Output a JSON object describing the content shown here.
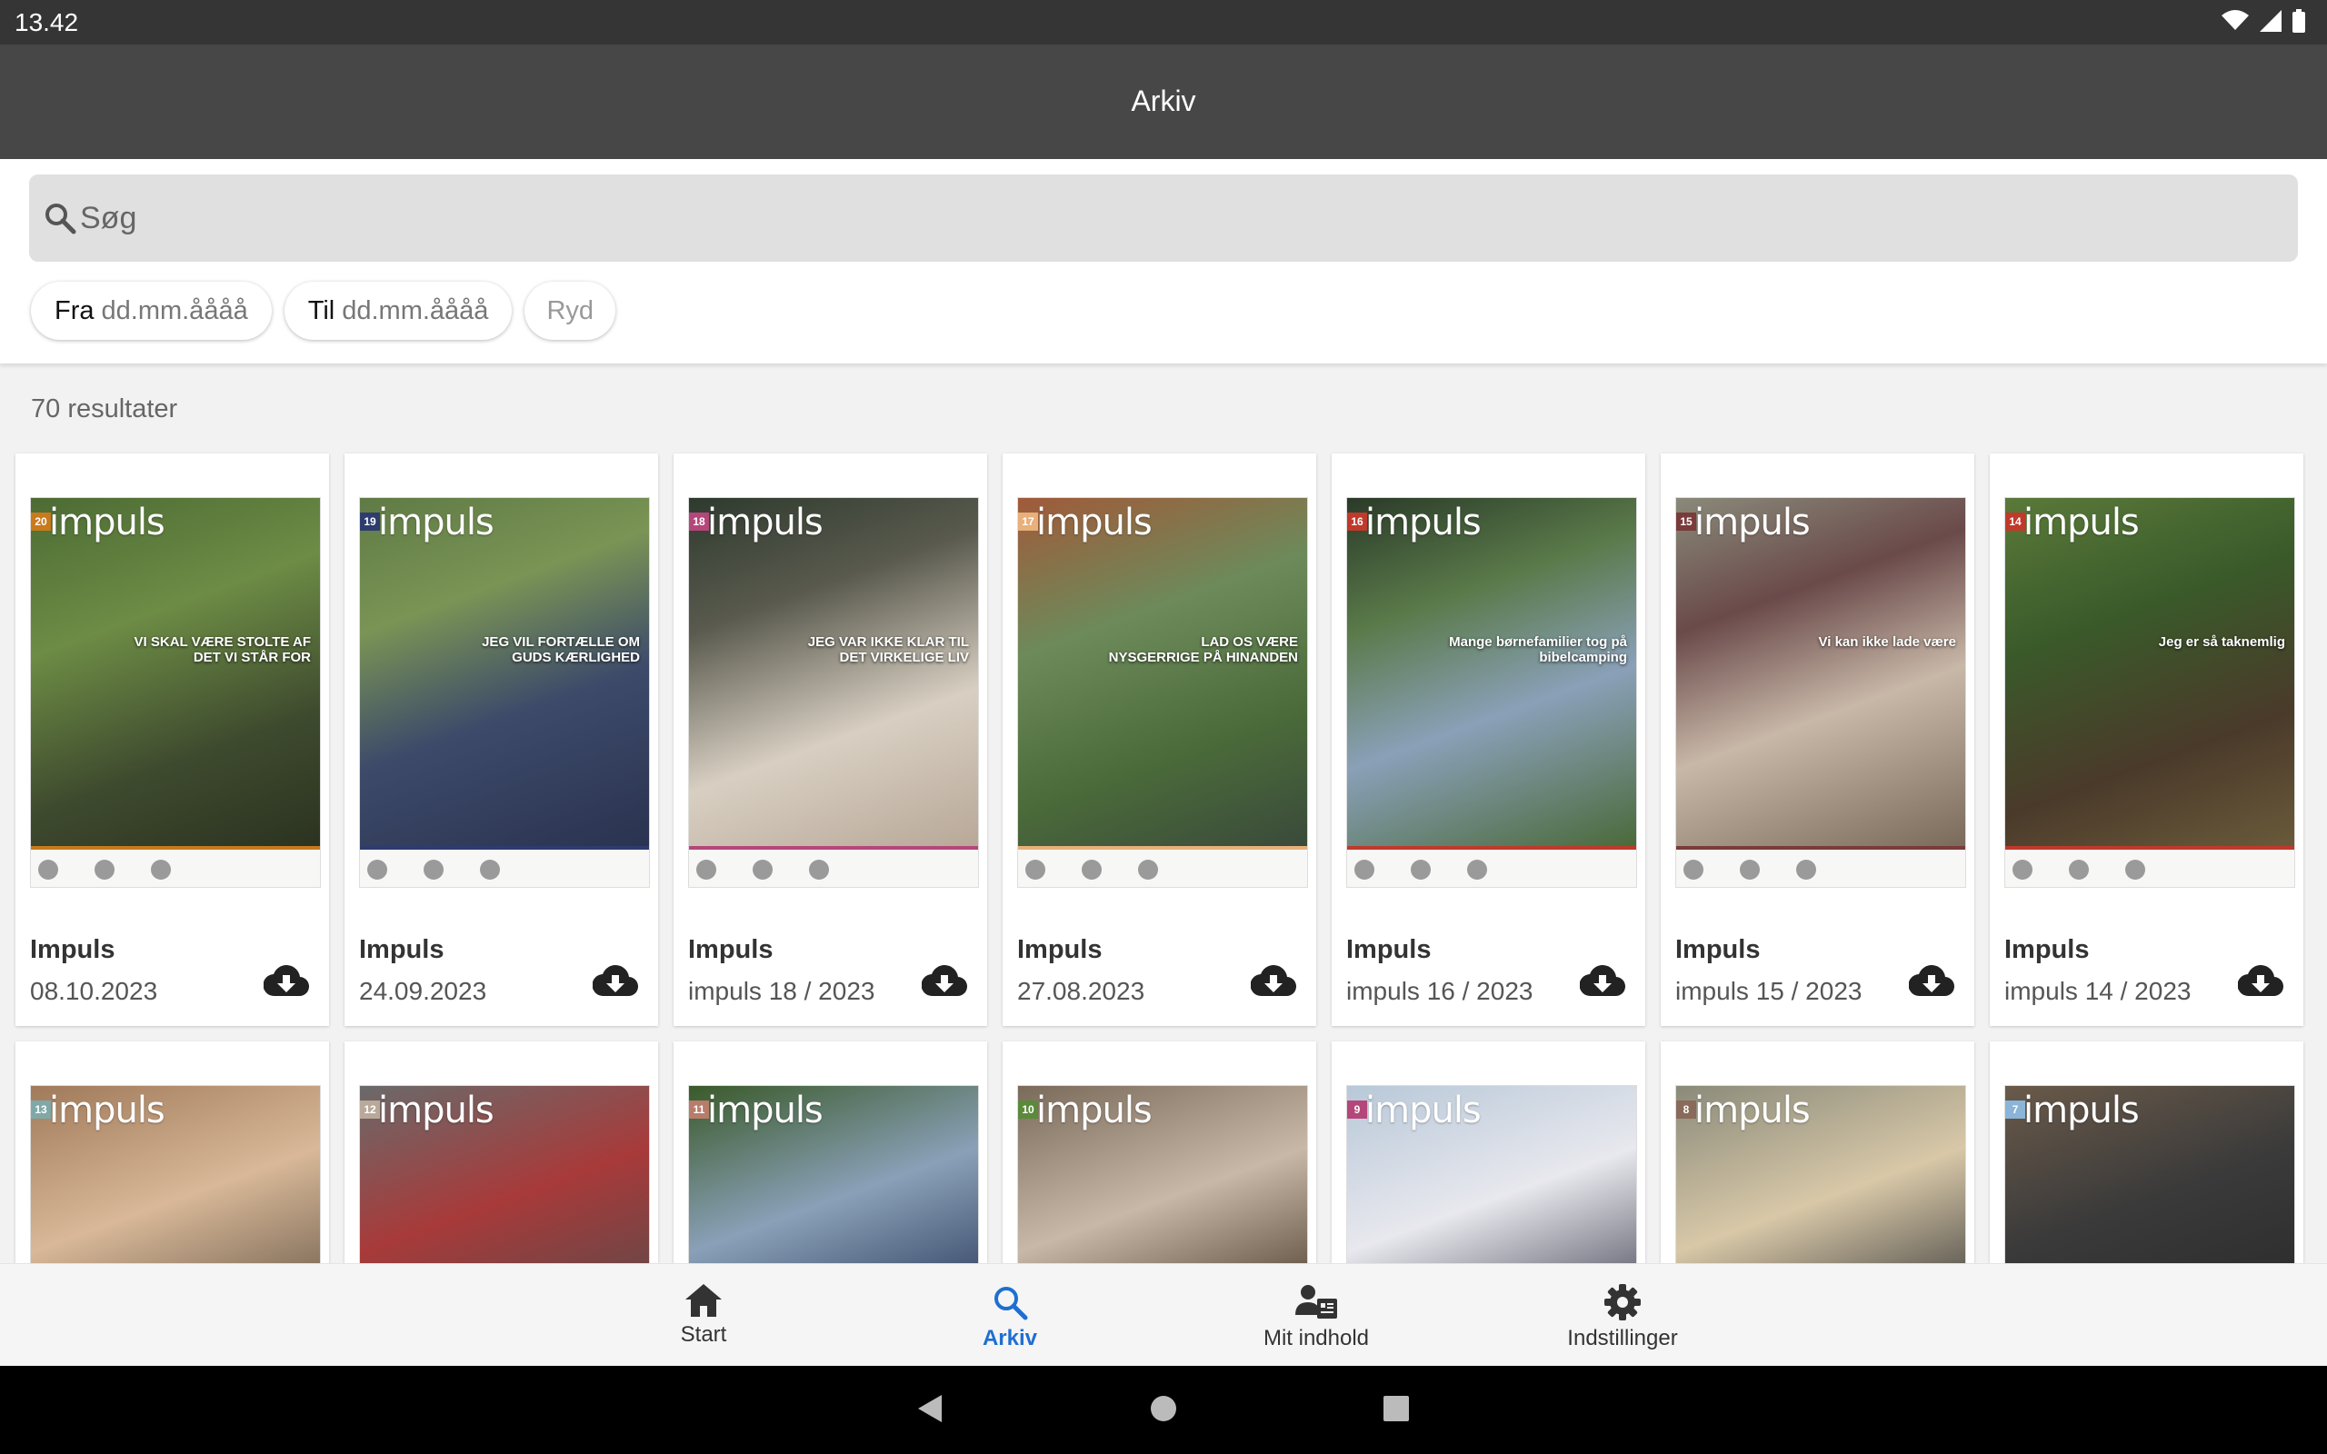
{
  "status_bar": {
    "time": "13.42",
    "icons": [
      "wifi-icon",
      "signal-icon",
      "battery-icon"
    ]
  },
  "app_bar": {
    "title": "Arkiv"
  },
  "search": {
    "placeholder": "Søg"
  },
  "filters": {
    "from": {
      "label": "Fra",
      "placeholder": "dd.mm.åååå"
    },
    "to": {
      "label": "Til",
      "placeholder": "dd.mm.åååå"
    },
    "clear_label": "Ryd"
  },
  "results_count": "70 resultater",
  "issues": [
    {
      "title": "Impuls",
      "subtitle": "08.10.2023",
      "number": "20",
      "badge_color": "#c97a1c",
      "headline": "VI SKAL VÆRE STOLTE AF DET VI STÅR FOR"
    },
    {
      "title": "Impuls",
      "subtitle": "24.09.2023",
      "number": "19",
      "badge_color": "#2e3c6e",
      "headline": "JEG VIL FORTÆLLE OM GUDS KÆRLIGHED"
    },
    {
      "title": "Impuls",
      "subtitle": "impuls 18 / 2023",
      "number": "18",
      "badge_color": "#b5467a",
      "headline": "JEG VAR IKKE KLAR TIL DET VIRKELIGE LIV"
    },
    {
      "title": "Impuls",
      "subtitle": "27.08.2023",
      "number": "17",
      "badge_color": "#e8b07a",
      "headline": "LAD OS VÆRE NYSGERRIGE PÅ HINANDEN"
    },
    {
      "title": "Impuls",
      "subtitle": "impuls 16 / 2023",
      "number": "16",
      "badge_color": "#c0392b",
      "headline": "Mange børnefamilier tog på bibelcamping"
    },
    {
      "title": "Impuls",
      "subtitle": "impuls 15 / 2023",
      "number": "15",
      "badge_color": "#7a3b3b",
      "headline": "Vi kan ikke lade være"
    },
    {
      "title": "Impuls",
      "subtitle": "impuls 14 / 2023",
      "number": "14",
      "badge_color": "#c0392b",
      "headline": "Jeg er så taknemlig"
    }
  ],
  "issues_row2": [
    {
      "number": "13",
      "badge_color": "#7fa9a8"
    },
    {
      "number": "12",
      "badge_color": "#b9a99a"
    },
    {
      "number": "11",
      "badge_color": "#b87c6a"
    },
    {
      "number": "10",
      "badge_color": "#5a8a3a"
    },
    {
      "number": "9",
      "badge_color": "#b5467a"
    },
    {
      "number": "8",
      "badge_color": "#8a6a5a"
    },
    {
      "number": "7",
      "badge_color": "#8ab4d8"
    }
  ],
  "bottom_nav": [
    {
      "label": "Start",
      "icon": "home-icon",
      "active": false
    },
    {
      "label": "Arkiv",
      "icon": "search-icon",
      "active": true
    },
    {
      "label": "Mit indhold",
      "icon": "my-content-icon",
      "active": false
    },
    {
      "label": "Indstillinger",
      "icon": "gear-icon",
      "active": false
    }
  ],
  "colors": {
    "accent": "#1f6fd1",
    "app_bar": "#474747",
    "status_bar": "#353535"
  }
}
